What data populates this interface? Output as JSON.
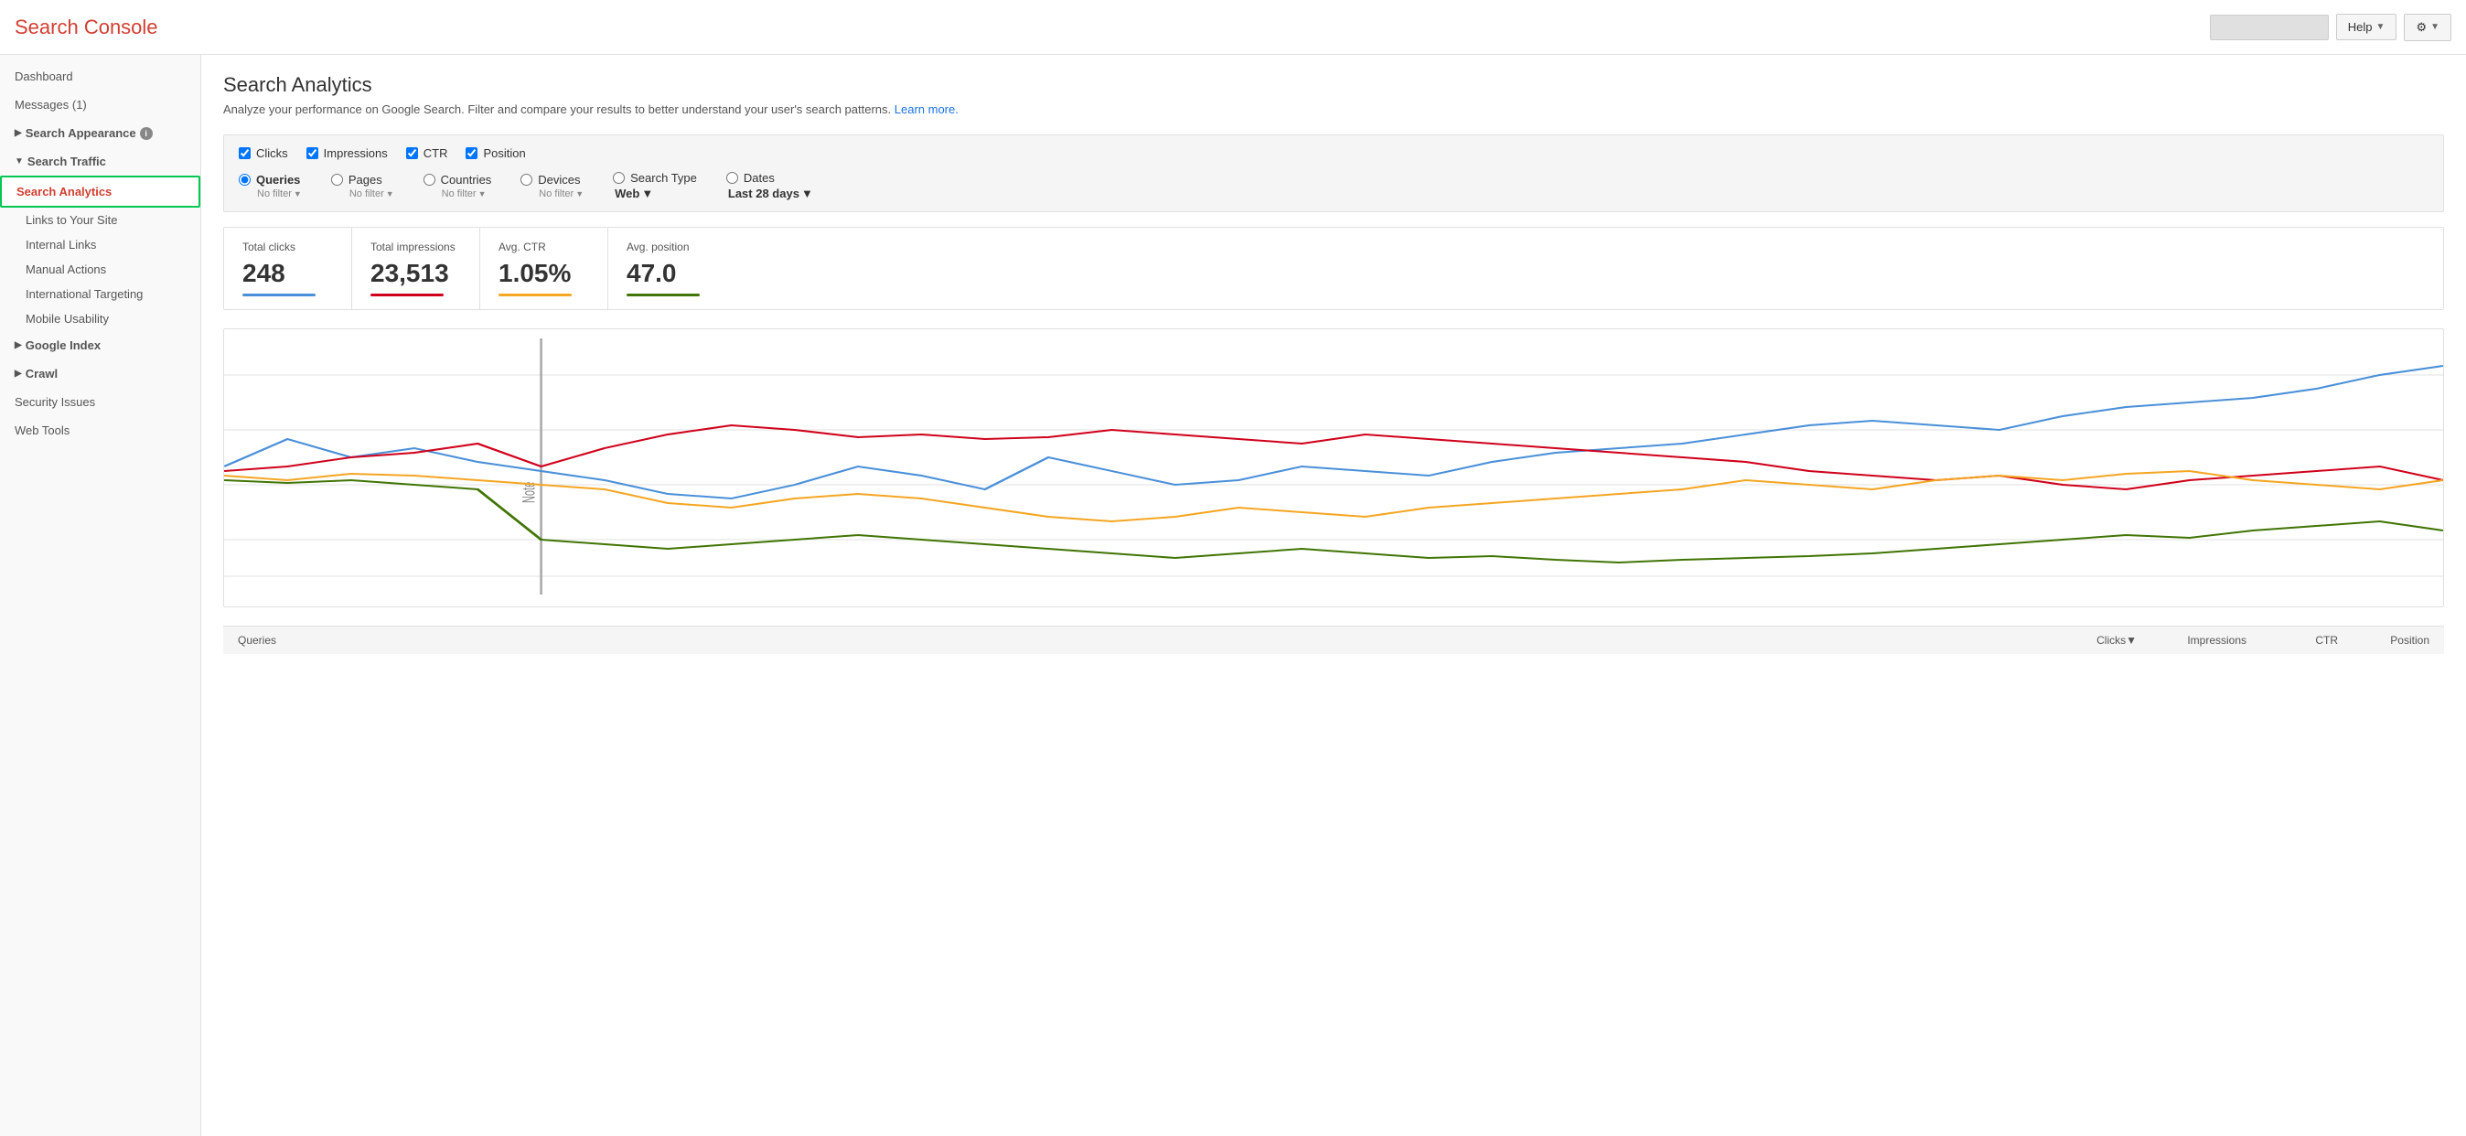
{
  "header": {
    "title": "Search Console",
    "help_label": "Help",
    "settings_label": "⚙"
  },
  "sidebar": {
    "dashboard": "Dashboard",
    "messages": "Messages (1)",
    "search_appearance": "Search Appearance",
    "search_traffic_section": "Search Traffic",
    "search_analytics": "Search Analytics",
    "links_to_site": "Links to Your Site",
    "internal_links": "Internal Links",
    "manual_actions": "Manual Actions",
    "international_targeting": "International Targeting",
    "mobile_usability": "Mobile Usability",
    "google_index": "Google Index",
    "crawl": "Crawl",
    "security_issues": "Security Issues",
    "web_tools": "Web Tools"
  },
  "main": {
    "page_title": "Search Analytics",
    "page_subtitle": "Analyze your performance on Google Search. Filter and compare your results to better understand your user's search patterns.",
    "learn_more": "Learn more.",
    "filter": {
      "checkboxes": [
        "Clicks",
        "Impressions",
        "CTR",
        "Position"
      ],
      "radio_options": [
        {
          "label": "Queries",
          "filter": "No filter"
        },
        {
          "label": "Pages",
          "filter": "No filter"
        },
        {
          "label": "Countries",
          "filter": "No filter"
        },
        {
          "label": "Devices",
          "filter": "No filter"
        }
      ],
      "search_type_label": "Search Type",
      "search_type_value": "Web",
      "dates_label": "Dates",
      "dates_value": "Last 28 days"
    },
    "stats": [
      {
        "label": "Total clicks",
        "value": "248",
        "bar_class": "bar-blue"
      },
      {
        "label": "Total impressions",
        "value": "23,513",
        "bar_class": "bar-red"
      },
      {
        "label": "Avg. CTR",
        "value": "1.05%",
        "bar_class": "bar-orange"
      },
      {
        "label": "Avg. position",
        "value": "47.0",
        "bar_class": "bar-green"
      }
    ],
    "table_headers": {
      "queries": "Queries",
      "clicks": "Clicks▼",
      "impressions": "Impressions",
      "ctr": "CTR",
      "position": "Position"
    },
    "chart": {
      "note": "Note"
    }
  }
}
